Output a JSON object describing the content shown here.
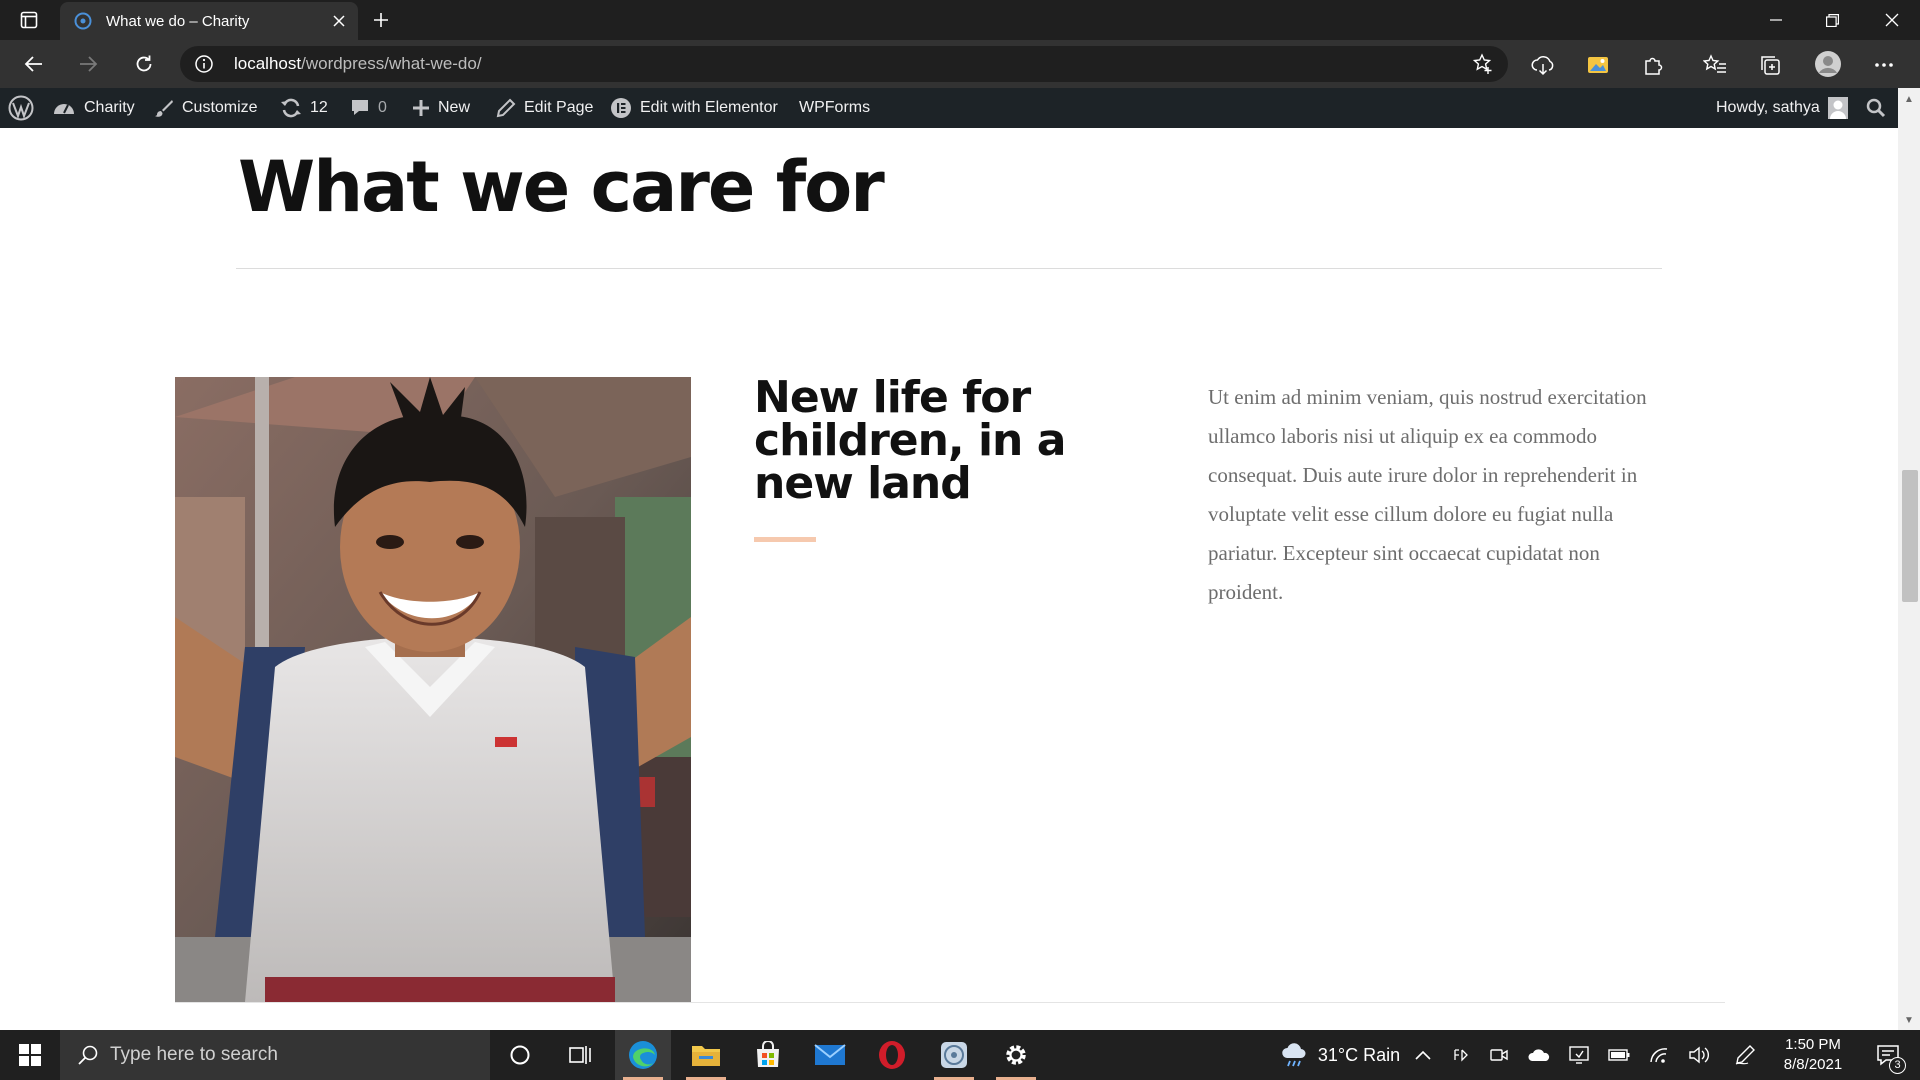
{
  "browser": {
    "tab_title": "What we do – Charity",
    "url_host": "localhost",
    "url_path": "/wordpress/what-we-do/"
  },
  "admin_bar": {
    "site_name": "Charity",
    "customize": "Customize",
    "updates_count": "12",
    "comments_count": "0",
    "new_label": "New",
    "edit_page": "Edit Page",
    "edit_elementor": "Edit with Elementor",
    "wpforms": "WPForms",
    "howdy": "Howdy, sathya"
  },
  "page": {
    "section_title": "What we care for",
    "card_heading": "New life for children, in a new land",
    "card_text": "Ut enim ad minim veniam, quis nostrud exercitation ullamco laboris nisi ut aliquip ex ea commodo consequat. Duis aute irure dolor in reprehenderit in voluptate velit esse cillum dolore eu fugiat nulla pariatur. Excepteur sint occaecat cupidatat non proident.",
    "accent_color": "#f6c9ae"
  },
  "taskbar": {
    "search_placeholder": "Type here to search",
    "weather": "31°C  Rain",
    "time": "1:50 PM",
    "date": "8/8/2021",
    "notifications": "3"
  }
}
